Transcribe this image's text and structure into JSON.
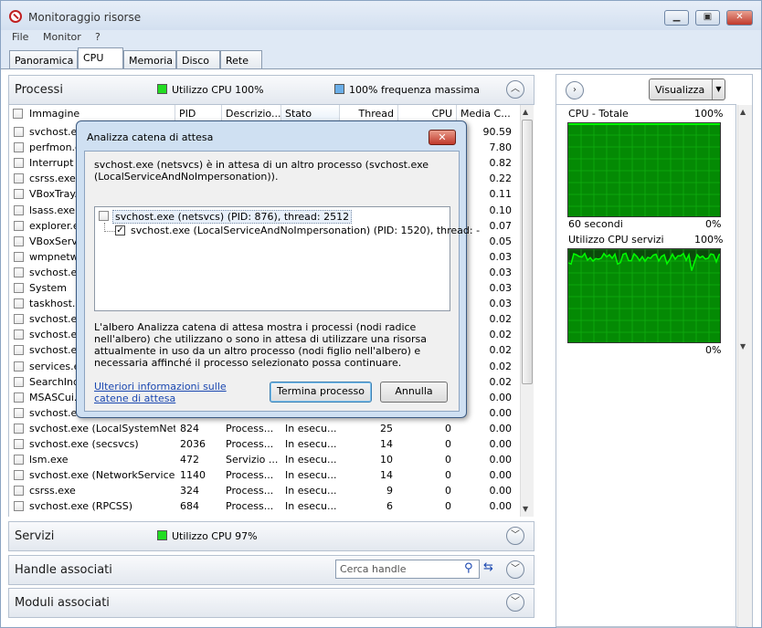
{
  "window": {
    "title": "Monitoraggio risorse"
  },
  "menu": [
    "File",
    "Monitor",
    "?"
  ],
  "tabs": [
    "Panoramica",
    "CPU",
    "Memoria",
    "Disco",
    "Rete"
  ],
  "processi": {
    "title": "Processi",
    "cpu_status": "Utilizzo CPU 100%",
    "freq_status": "100% frequenza massima",
    "status_color": "#22dd22",
    "freq_color": "#6aaee8",
    "columns": [
      "Immagine",
      "PID",
      "Descrizio...",
      "Stato",
      "Thread",
      "CPU",
      "Media C..."
    ],
    "rows": [
      {
        "name": "svchost.exe",
        "pid": "",
        "desc": "",
        "stato": "",
        "thread": "",
        "cpu": "",
        "media": "90.59"
      },
      {
        "name": "perfmon.e",
        "pid": "",
        "desc": "",
        "stato": "",
        "thread": "",
        "cpu": "",
        "media": "7.80"
      },
      {
        "name": "Interrupt",
        "pid": "",
        "desc": "",
        "stato": "",
        "thread": "",
        "cpu": "",
        "media": "0.82"
      },
      {
        "name": "csrss.exe",
        "pid": "",
        "desc": "",
        "stato": "",
        "thread": "",
        "cpu": "",
        "media": "0.22"
      },
      {
        "name": "VBoxTray.e",
        "pid": "",
        "desc": "",
        "stato": "",
        "thread": "",
        "cpu": "",
        "media": "0.11"
      },
      {
        "name": "lsass.exe",
        "pid": "",
        "desc": "",
        "stato": "",
        "thread": "",
        "cpu": "",
        "media": "0.10"
      },
      {
        "name": "explorer.e",
        "pid": "",
        "desc": "",
        "stato": "",
        "thread": "",
        "cpu": "",
        "media": "0.07"
      },
      {
        "name": "VBoxServi",
        "pid": "",
        "desc": "",
        "stato": "",
        "thread": "",
        "cpu": "",
        "media": "0.05"
      },
      {
        "name": "wmpnetw",
        "pid": "",
        "desc": "",
        "stato": "",
        "thread": "",
        "cpu": "",
        "media": "0.03"
      },
      {
        "name": "svchost.ex",
        "pid": "",
        "desc": "",
        "stato": "",
        "thread": "",
        "cpu": "",
        "media": "0.03"
      },
      {
        "name": "System",
        "pid": "",
        "desc": "",
        "stato": "",
        "thread": "",
        "cpu": "",
        "media": "0.03"
      },
      {
        "name": "taskhost.e",
        "pid": "",
        "desc": "",
        "stato": "",
        "thread": "",
        "cpu": "",
        "media": "0.03"
      },
      {
        "name": "svchost.ex",
        "pid": "",
        "desc": "",
        "stato": "",
        "thread": "",
        "cpu": "",
        "media": "0.02"
      },
      {
        "name": "svchost.ex",
        "pid": "",
        "desc": "",
        "stato": "",
        "thread": "",
        "cpu": "",
        "media": "0.02"
      },
      {
        "name": "svchost.ex",
        "pid": "",
        "desc": "",
        "stato": "",
        "thread": "",
        "cpu": "",
        "media": "0.02"
      },
      {
        "name": "services.e",
        "pid": "",
        "desc": "",
        "stato": "",
        "thread": "",
        "cpu": "",
        "media": "0.02"
      },
      {
        "name": "SearchInd",
        "pid": "",
        "desc": "",
        "stato": "",
        "thread": "",
        "cpu": "",
        "media": "0.02"
      },
      {
        "name": "MSASCui.e",
        "pid": "",
        "desc": "",
        "stato": "",
        "thread": "",
        "cpu": "",
        "media": "0.00"
      },
      {
        "name": "svchost.ex",
        "pid": "",
        "desc": "",
        "stato": "",
        "thread": "",
        "cpu": "",
        "media": "0.00"
      },
      {
        "name": "svchost.exe (LocalSystemNet...",
        "pid": "824",
        "desc": "Process...",
        "stato": "In esecu...",
        "thread": "25",
        "cpu": "0",
        "media": "0.00"
      },
      {
        "name": "svchost.exe (secsvcs)",
        "pid": "2036",
        "desc": "Process...",
        "stato": "In esecu...",
        "thread": "14",
        "cpu": "0",
        "media": "0.00"
      },
      {
        "name": "lsm.exe",
        "pid": "472",
        "desc": "Servizio ...",
        "stato": "In esecu...",
        "thread": "10",
        "cpu": "0",
        "media": "0.00"
      },
      {
        "name": "svchost.exe (NetworkService)",
        "pid": "1140",
        "desc": "Process...",
        "stato": "In esecu...",
        "thread": "14",
        "cpu": "0",
        "media": "0.00"
      },
      {
        "name": "csrss.exe",
        "pid": "324",
        "desc": "Process...",
        "stato": "In esecu...",
        "thread": "9",
        "cpu": "0",
        "media": "0.00"
      },
      {
        "name": "svchost.exe (RPCSS)",
        "pid": "684",
        "desc": "Process...",
        "stato": "In esecu...",
        "thread": "6",
        "cpu": "0",
        "media": "0.00"
      }
    ]
  },
  "servizi": {
    "title": "Servizi",
    "cpu_status": "Utilizzo CPU 97%"
  },
  "handle": {
    "title": "Handle associati",
    "search_placeholder": "Cerca handle"
  },
  "moduli": {
    "title": "Moduli associati"
  },
  "right": {
    "view_button": "Visualizza",
    "g1_title": "CPU - Totale",
    "g1_max": "100%",
    "g1_time": "60 secondi",
    "g1_min": "0%",
    "g2_title": "Utilizzo CPU servizi",
    "g2_max": "100%",
    "g2_min": "0%",
    "graph_color": "#00c000"
  },
  "dialog": {
    "title": "Analizza catena di attesa",
    "close": "✕",
    "message": "svchost.exe (netsvcs) è in attesa di un altro processo (svchost.exe (LocalServiceAndNoImpersonation)).",
    "tree_root": "svchost.exe (netsvcs) (PID: 876), thread: 2512",
    "tree_child": "svchost.exe (LocalServiceAndNoImpersonation) (PID: 1520), thread: -",
    "description": "L'albero Analizza catena di attesa mostra i processi (nodi radice nell'albero) che utilizzano o sono in attesa di utilizzare una risorsa attualmente in uso da un altro processo (nodi figlio nell'albero) e necessaria affinché il processo selezionato possa continuare.",
    "link": "Ulteriori informazioni sulle catene di attesa",
    "btn_end": "Termina processo",
    "btn_cancel": "Annulla"
  }
}
